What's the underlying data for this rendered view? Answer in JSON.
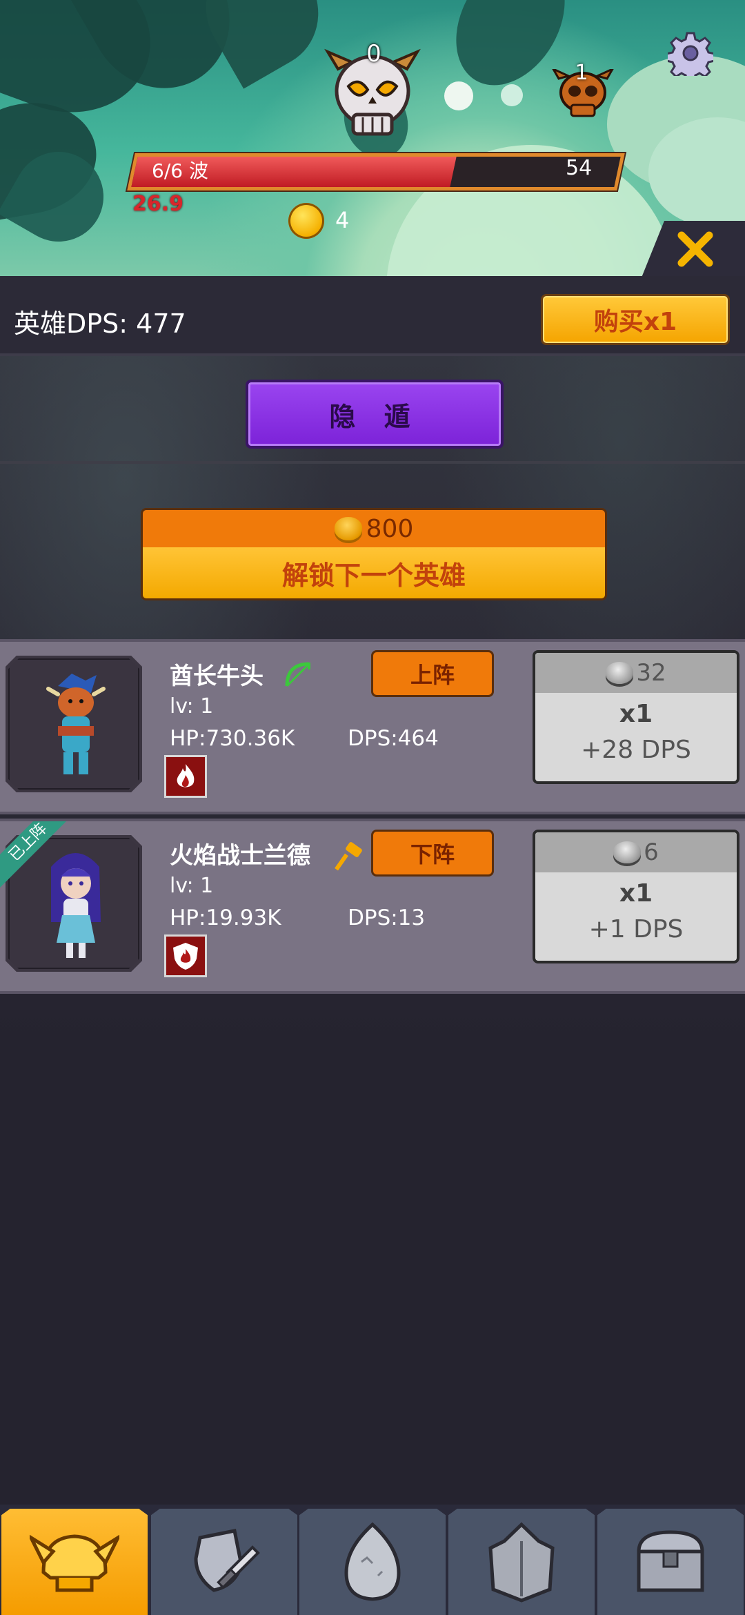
{
  "status": {
    "skull_count": "0",
    "boss_count": "1",
    "wave_label": "6/6 波",
    "wave_value": "54",
    "wave_progress": 0.66,
    "timer": "26.9",
    "coins": "4"
  },
  "header": {
    "title": "英雄DPS: 477",
    "buy_label": "购买x1"
  },
  "stealth_label": "隐 遁",
  "unlock": {
    "cost": "800",
    "label": "解锁下一个英雄"
  },
  "heroes": [
    {
      "name": "酋长牛头",
      "lv": "lv: 1",
      "hp": "HP:730.36K",
      "dps": "DPS:464",
      "deploy_label": "上阵",
      "upgrade_cost": "32",
      "upgrade_mult": "x1",
      "upgrade_dps": "+28 DPS",
      "class_icon": "bow-icon",
      "element_icon": "fire-icon"
    },
    {
      "name": "火焰战士兰德",
      "lv": "lv: 1",
      "hp": "HP:19.93K",
      "dps": "DPS:13",
      "deploy_label": "下阵",
      "upgrade_cost": "6",
      "upgrade_mult": "x1",
      "upgrade_dps": "+1 DPS",
      "ribbon": "已上阵",
      "class_icon": "hammer-icon",
      "element_icon": "fire-shield-icon"
    }
  ],
  "nav": [
    "helmet-icon",
    "shield-sword-icon",
    "egg-icon",
    "armor-icon",
    "treasure-chest-icon"
  ],
  "colors": {
    "accent_orange": "#f07a0a",
    "accent_gold": "#ffc436",
    "purple": "#8a33e4",
    "wave_red": "#d8262b",
    "row_bg": "#7a7384"
  }
}
